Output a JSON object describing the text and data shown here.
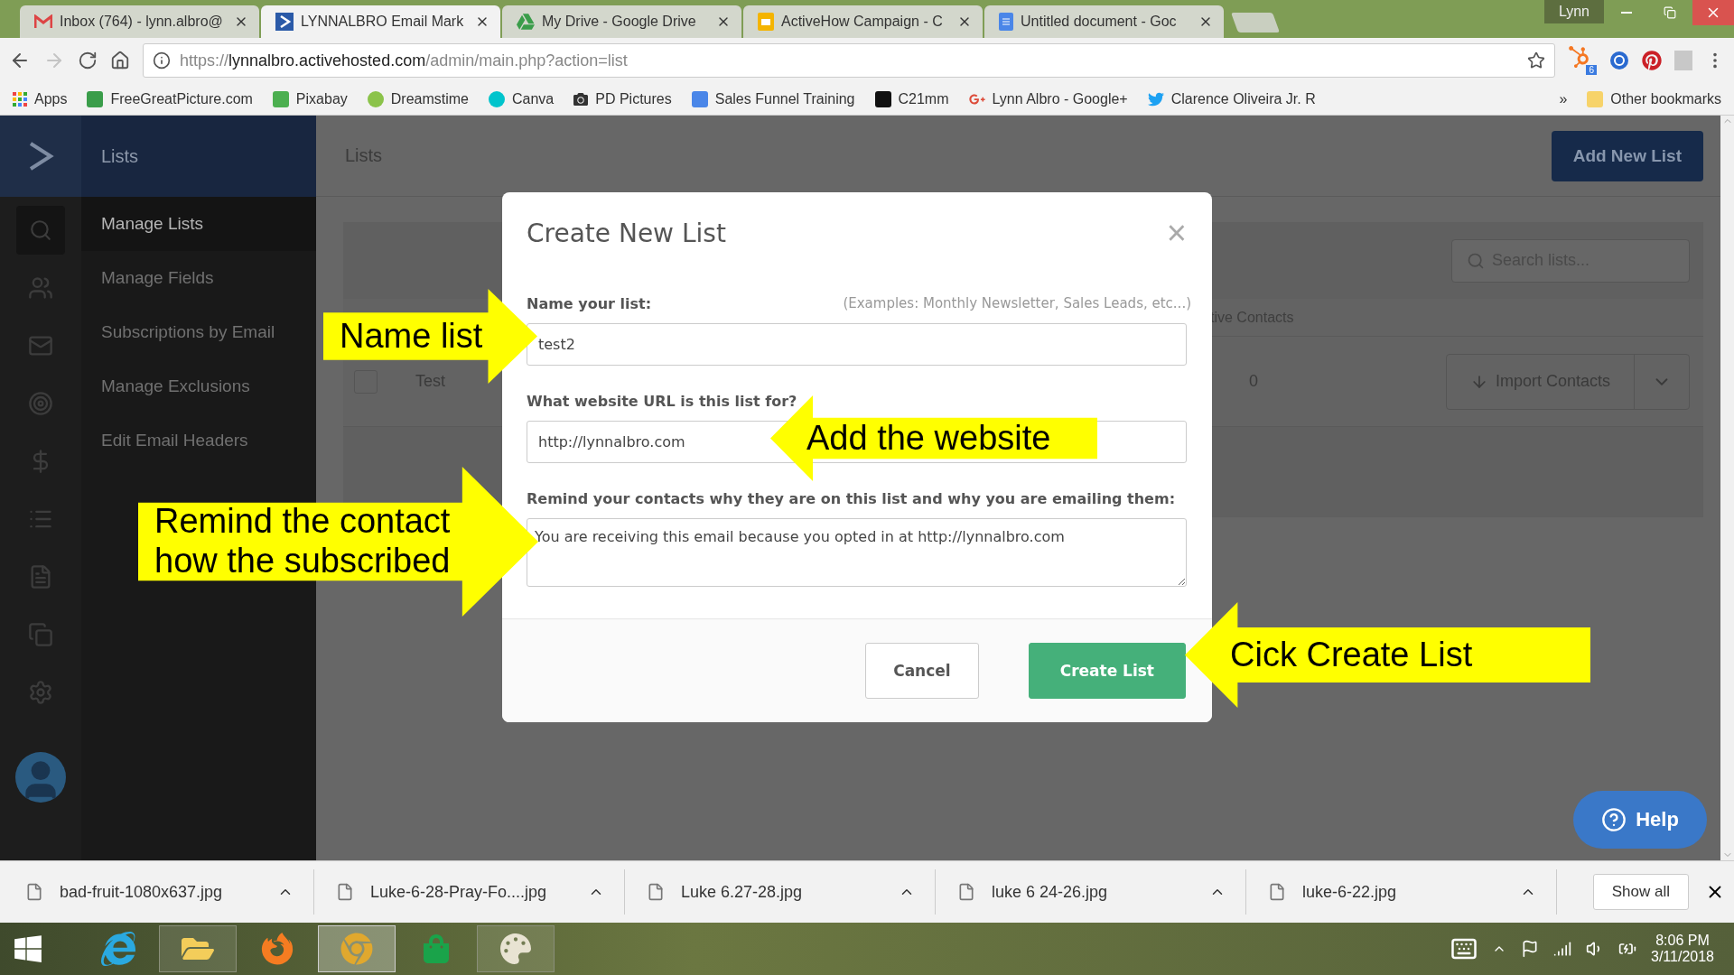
{
  "browser": {
    "tabs": [
      {
        "kind": "gmail",
        "title": "Inbox (764) - lynn.albro@",
        "selected": false
      },
      {
        "kind": "activecampaign",
        "title": "LYNNALBRO Email Mark",
        "selected": true
      },
      {
        "kind": "drive",
        "title": "My Drive - Google Drive",
        "selected": false
      },
      {
        "kind": "slides",
        "title": "ActiveHow Campaign - C",
        "selected": false
      },
      {
        "kind": "docs",
        "title": "Untitled document - Goc",
        "selected": false
      }
    ],
    "profile": "Lynn",
    "forward_disabled": true,
    "url": {
      "scheme": "https://",
      "host": "lynnalbro.activehosted.com",
      "path": "/admin/main.php?action=list"
    },
    "extension_badge": "6",
    "bookmarks": [
      {
        "kind": "apps",
        "label": "Apps"
      },
      {
        "kind": "m",
        "label": "FreeGreatPicture.com"
      },
      {
        "kind": "px",
        "label": "Pixabay"
      },
      {
        "kind": "swirl",
        "label": "Dreamstime"
      },
      {
        "kind": "canva",
        "label": "Canva"
      },
      {
        "kind": "camera",
        "label": "PD Pictures"
      },
      {
        "kind": "doc",
        "label": "Sales Funnel Training"
      },
      {
        "kind": "dark",
        "label": "C21mm"
      },
      {
        "kind": "gplus",
        "label": "Lynn Albro - Google+"
      },
      {
        "kind": "twitter",
        "label": "Clarence Oliveira Jr. R"
      }
    ],
    "overflow": "»",
    "other_bookmarks": "Other bookmarks"
  },
  "app": {
    "section": "Lists",
    "page_title": "Lists",
    "add_button": "Add New List",
    "menu": [
      {
        "label": "Manage Lists",
        "selected": true
      },
      {
        "label": "Manage Fields",
        "selected": false
      },
      {
        "label": "Subscriptions by Email",
        "selected": false
      },
      {
        "label": "Manage Exclusions",
        "selected": false
      },
      {
        "label": "Edit Email Headers",
        "selected": false
      }
    ],
    "search": {
      "placeholder": "Search lists..."
    },
    "table": {
      "column_3": "tive Contacts",
      "rows": [
        {
          "name": "Test",
          "checked": false,
          "active_contacts": "0",
          "action": "Import Contacts"
        }
      ]
    },
    "help": "Help"
  },
  "dialog": {
    "title": "Create New List",
    "close": "×",
    "fields": [
      {
        "kind": "input",
        "label": "Name your list:",
        "hint": "(Examples: Monthly Newsletter, Sales Leads, etc...)",
        "value": "test2"
      },
      {
        "kind": "input",
        "label": "What website URL is this list for?",
        "value": "http://lynnalbro.com"
      },
      {
        "kind": "textarea",
        "label": "Remind your contacts why they are on this list and why you are emailing them:",
        "value": "You are receiving this email because you opted in at http://lynnalbro.com"
      }
    ],
    "buttons": [
      {
        "kind": "secondary",
        "label": "Cancel"
      },
      {
        "kind": "primary",
        "label": "Create List"
      }
    ]
  },
  "callouts": [
    {
      "text": "Name list",
      "kind": "right"
    },
    {
      "text": "Add the website",
      "kind": "left"
    },
    {
      "text": "Remind the contact how the subscribed",
      "kind": "right"
    },
    {
      "text": "Cick Create List",
      "kind": "left"
    }
  ],
  "downloads": {
    "files": [
      "bad-fruit-1080x637.jpg",
      "Luke-6-28-Pray-Fo....jpg",
      "Luke 6.27-28.jpg",
      "luke 6 24-26.jpg",
      "luke-6-22.jpg"
    ],
    "show_all": "Show all"
  },
  "taskbar": {
    "apps": [
      {
        "kind": "ie",
        "running": false,
        "selected": false
      },
      {
        "kind": "explorer",
        "running": true,
        "selected": false
      },
      {
        "kind": "firefox",
        "running": false,
        "selected": false
      },
      {
        "kind": "chrome",
        "running": true,
        "selected": true
      },
      {
        "kind": "store",
        "running": false,
        "selected": false
      },
      {
        "kind": "paint",
        "running": true,
        "selected": false
      }
    ],
    "time": "8:06 PM",
    "date": "3/11/2018"
  }
}
